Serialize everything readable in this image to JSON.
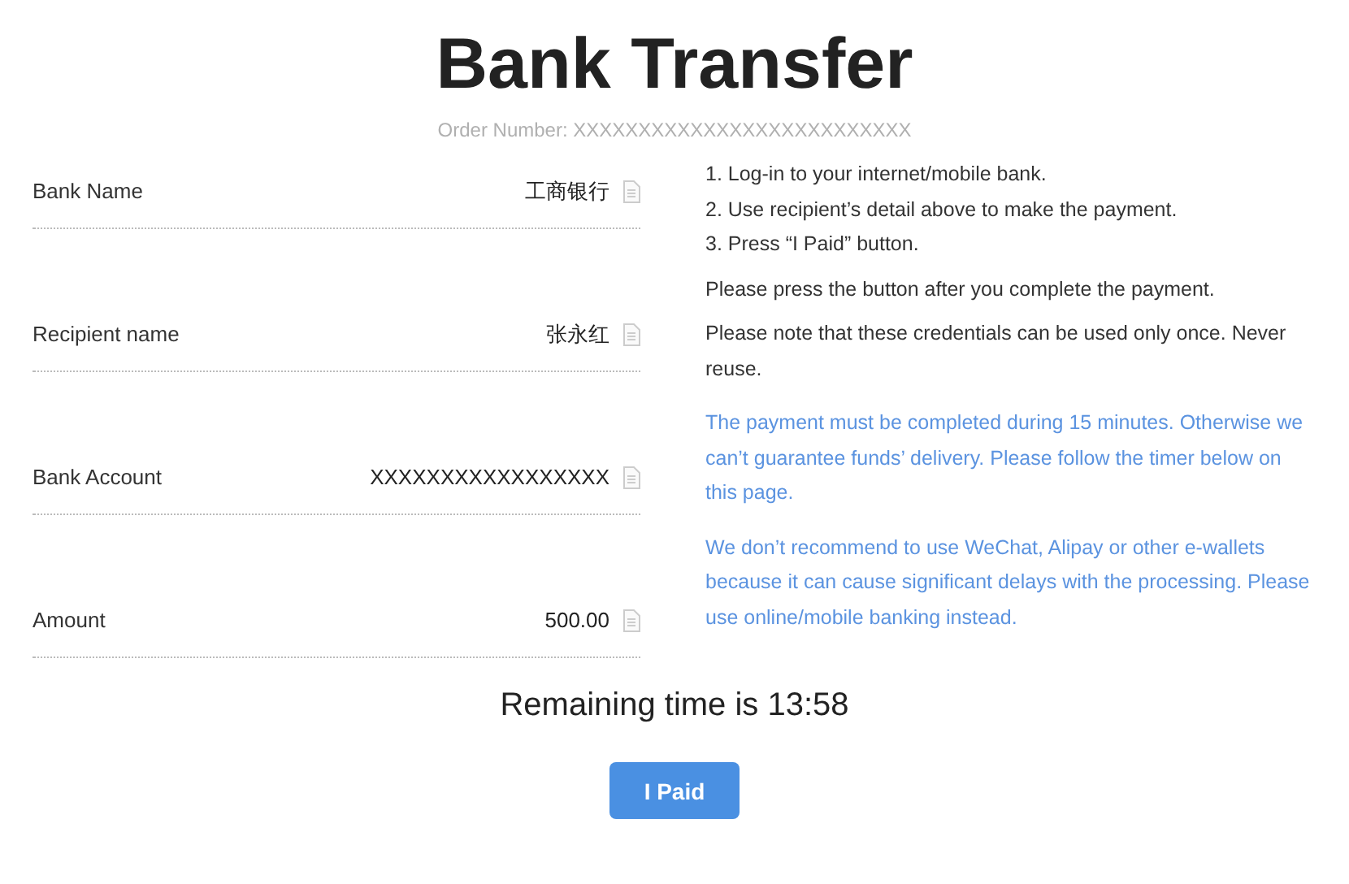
{
  "title": "Bank Transfer",
  "order_number": "Order Number: XXXXXXXXXXXXXXXXXXXXXXXXXX",
  "details": [
    {
      "label": "Bank Name",
      "value": "工商银行"
    },
    {
      "label": "Recipient name",
      "value": "张永红"
    },
    {
      "label": "Bank Account",
      "value": "XXXXXXXXXXXXXXXXX"
    },
    {
      "label": "Amount",
      "value": "500.00"
    }
  ],
  "steps": [
    "1. Log-in to your internet/mobile bank.",
    "2. Use recipient’s detail above to make the payment.",
    "3. Press “I Paid” button."
  ],
  "notes": [
    {
      "kind": "info",
      "text": "Please press the button after you complete the payment."
    },
    {
      "kind": "info",
      "text": "Please note that these credentials can be used only once. Never reuse."
    },
    {
      "kind": "warning",
      "text": "The payment must be completed during 15 minutes. Otherwise we can’t guarantee funds’ delivery. Please follow the timer below on this page."
    },
    {
      "kind": "warning",
      "text": "We don’t recommend to use WeChat, Alipay or other e-wallets because it can cause significant delays with the processing. Please use online/mobile banking instead."
    }
  ],
  "timer": "Remaining time is 13:58",
  "button": "I Paid"
}
